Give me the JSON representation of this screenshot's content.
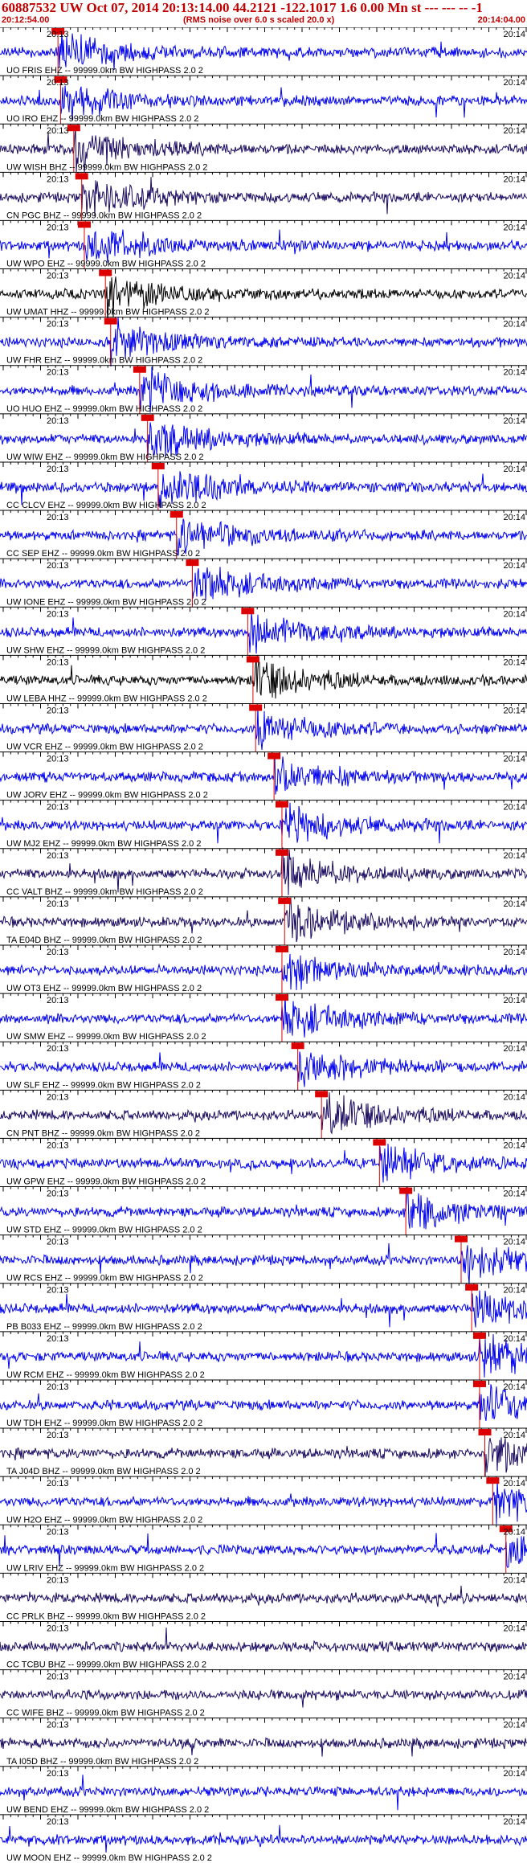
{
  "header": {
    "title": "60887532 UW Oct 07, 2014 20:13:14.00   44.2121 -122.1017  1.6 0.00 Mn st --- --- -- -1",
    "time_start": "20:12:54.00",
    "rms_note": "(RMS noise over 6.0 s scaled 20.0 x)",
    "time_end": "20:14:04.00"
  },
  "colors": {
    "trace": "#0000ee",
    "dark": "#000000",
    "navy": "#1a0a60",
    "pick": "#dd0000",
    "text": "#c00000"
  },
  "traces": [
    {
      "station": "UO FRIS",
      "label": "UO FRIS EHZ -- 99999.0km BW  HIGHPASS  2.0  2",
      "t_left": "20:13",
      "t_right": "20:14",
      "pick": 0.11,
      "color": "blue"
    },
    {
      "station": "UO IRO",
      "label": "UO IRO  EHZ -- 99999.0km BW  HIGHPASS  2.0  2",
      "t_left": "20:13",
      "t_right": "20:14",
      "pick": 0.115,
      "color": "blue"
    },
    {
      "station": "UW WISH",
      "label": "UW WISH BHZ -- 99999.0km BW  HIGHPASS  2.0  2",
      "t_left": "20:13",
      "t_right": "20:14",
      "pick": 0.14,
      "color": "navy"
    },
    {
      "station": "CN PGC",
      "label": "CN PGC  BHZ -- 99999.0km BW  HIGHPASS  2.0  2",
      "t_left": "20:13",
      "t_right": "20:14",
      "pick": 0.155,
      "color": "navy"
    },
    {
      "station": "UW WPO",
      "label": "UW WPO  EHZ -- 99999.0km BW  HIGHPASS  2.0  2",
      "t_left": "20:13",
      "t_right": "20:14",
      "pick": 0.16,
      "color": "blue"
    },
    {
      "station": "UW UMAT",
      "label": "UW UMAT HHZ -- 99999.0km BW  HIGHPASS  2.0  2",
      "t_left": "20:13",
      "t_right": "20:14",
      "pick": 0.2,
      "color": "dark"
    },
    {
      "station": "UW FHR",
      "label": "UW FHR  EHZ -- 99999.0km BW  HIGHPASS  2.0  2",
      "t_left": "20:13",
      "t_right": "20:14",
      "pick": 0.21,
      "color": "blue"
    },
    {
      "station": "UO HUO",
      "label": "UO HUO  EHZ -- 99999.0km BW  HIGHPASS  2.0  2",
      "t_left": "20:13",
      "t_right": "20:14",
      "pick": 0.265,
      "color": "blue"
    },
    {
      "station": "UW WIW",
      "label": "UW WIW  EHZ -- 99999.0km BW  HIGHPASS  2.0  2",
      "t_left": "20:13",
      "t_right": "20:14",
      "pick": 0.28,
      "color": "blue"
    },
    {
      "station": "CC CLCV",
      "label": "CC CLCV EHZ -- 99999.0km BW  HIGHPASS  2.0  2",
      "t_left": "20:13",
      "t_right": "20:14",
      "pick": 0.3,
      "color": "blue"
    },
    {
      "station": "CC SEP",
      "label": "CC SEP  EHZ -- 99999.0km BW  HIGHPASS  2.0  2",
      "t_left": "20:13",
      "t_right": "20:14",
      "pick": 0.335,
      "color": "blue"
    },
    {
      "station": "UW IONE",
      "label": "UW IONE EHZ -- 99999.0km BW  HIGHPASS  2.0  2",
      "t_left": "20:13",
      "t_right": "20:14",
      "pick": 0.365,
      "color": "blue"
    },
    {
      "station": "UW SHW",
      "label": "UW SHW  EHZ -- 99999.0km BW  HIGHPASS  2.0  2",
      "t_left": "20:13",
      "t_right": "20:14",
      "pick": 0.47,
      "color": "blue"
    },
    {
      "station": "UW LEBA",
      "label": "UW LEBA HHZ -- 99999.0km BW  HIGHPASS  2.0  2",
      "t_left": "20:13",
      "t_right": "20:14",
      "pick": 0.48,
      "color": "dark"
    },
    {
      "station": "UW VCR",
      "label": "UW VCR  EHZ -- 99999.0km BW  HIGHPASS  2.0  2",
      "t_left": "20:13",
      "t_right": "20:14",
      "pick": 0.485,
      "color": "blue"
    },
    {
      "station": "UW JORV",
      "label": "UW JORV EHZ -- 99999.0km BW  HIGHPASS  2.0  2",
      "t_left": "20:13",
      "t_right": "20:14",
      "pick": 0.52,
      "color": "blue"
    },
    {
      "station": "UW MJ2",
      "label": "UW MJ2  EHZ -- 99999.0km BW  HIGHPASS  2.0  2",
      "t_left": "20:13",
      "t_right": "20:14",
      "pick": 0.535,
      "color": "blue"
    },
    {
      "station": "CC VALT",
      "label": "CC VALT BHZ -- 99999.0km BW  HIGHPASS  2.0  2",
      "t_left": "20:13",
      "t_right": "20:14",
      "pick": 0.535,
      "color": "navy"
    },
    {
      "station": "TA E04D",
      "label": "TA E04D BHZ -- 99999.0km BW  HIGHPASS  2.0  2",
      "t_left": "20:13",
      "t_right": "20:14",
      "pick": 0.54,
      "color": "navy"
    },
    {
      "station": "UW OT3",
      "label": "UW OT3  EHZ -- 99999.0km BW  HIGHPASS  2.0  2",
      "t_left": "20:13",
      "t_right": "20:14",
      "pick": 0.535,
      "color": "blue"
    },
    {
      "station": "UW SMW",
      "label": "UW SMW  EHZ -- 99999.0km BW  HIGHPASS  2.0  2",
      "t_left": "20:13",
      "t_right": "20:14",
      "pick": 0.535,
      "color": "blue"
    },
    {
      "station": "UW SLF",
      "label": "UW SLF  EHZ -- 99999.0km BW  HIGHPASS  2.0  2",
      "t_left": "20:13",
      "t_right": "20:14",
      "pick": 0.565,
      "color": "blue"
    },
    {
      "station": "CN PNT",
      "label": "CN PNT  BHZ -- 99999.0km BW  HIGHPASS  2.0  2",
      "t_left": "20:13",
      "t_right": "20:14",
      "pick": 0.61,
      "color": "navy"
    },
    {
      "station": "UW GPW",
      "label": "UW GPW  EHZ -- 99999.0km BW  HIGHPASS  2.0  2",
      "t_left": "20:13",
      "t_right": "20:14",
      "pick": 0.72,
      "color": "blue"
    },
    {
      "station": "UW STD",
      "label": "UW STD  EHZ -- 99999.0km BW  HIGHPASS  2.0  2",
      "t_left": "20:13",
      "t_right": "20:14",
      "pick": 0.77,
      "color": "blue"
    },
    {
      "station": "UW RCS",
      "label": "UW RCS  EHZ -- 99999.0km BW  HIGHPASS  2.0  2",
      "t_left": "20:13",
      "t_right": "20:14",
      "pick": 0.875,
      "color": "blue"
    },
    {
      "station": "PB B033",
      "label": "PB B033 EHZ -- 99999.0km BW  HIGHPASS  2.0  2",
      "t_left": "20:13",
      "t_right": "20:14",
      "pick": 0.895,
      "color": "blue"
    },
    {
      "station": "UW RCM",
      "label": "UW RCM  EHZ -- 99999.0km BW  HIGHPASS  2.0  2",
      "t_left": "20:13",
      "t_right": "20:14",
      "pick": 0.91,
      "color": "blue"
    },
    {
      "station": "UW TDH",
      "label": "UW TDH  EHZ -- 99999.0km BW  HIGHPASS  2.0  2",
      "t_left": "20:13",
      "t_right": "20:14",
      "pick": 0.91,
      "color": "blue"
    },
    {
      "station": "TA J04D",
      "label": "TA J04D BHZ -- 99999.0km BW  HIGHPASS  2.0  2",
      "t_left": "20:13",
      "t_right": "20:14",
      "pick": 0.92,
      "color": "navy"
    },
    {
      "station": "UW H2O",
      "label": "UW H2O  EHZ -- 99999.0km BW  HIGHPASS  2.0  2",
      "t_left": "20:13",
      "t_right": "20:14",
      "pick": 0.935,
      "color": "blue"
    },
    {
      "station": "UW LRIV",
      "label": "UW LRIV EHZ -- 99999.0km BW  HIGHPASS  2.0  2",
      "t_left": "20:13",
      "t_right": "20:14",
      "pick": 0.96,
      "color": "blue"
    },
    {
      "station": "CC PRLK",
      "label": "CC PRLK BHZ -- 99999.0km BW  HIGHPASS  2.0  2",
      "t_left": "20:13",
      "t_right": "20:14",
      "pick": null,
      "color": "navy"
    },
    {
      "station": "CC TCBU",
      "label": "CC TCBU BHZ -- 99999.0km BW  HIGHPASS  2.0  2",
      "t_left": "20:13",
      "t_right": "20:14",
      "pick": null,
      "color": "navy"
    },
    {
      "station": "CC WIFE",
      "label": "CC WIFE BHZ -- 99999.0km BW  HIGHPASS  2.0  2",
      "t_left": "20:13",
      "t_right": "20:14",
      "pick": null,
      "color": "navy"
    },
    {
      "station": "TA I05D",
      "label": "TA I05D BHZ -- 99999.0km BW  HIGHPASS  2.0  2",
      "t_left": "20:13",
      "t_right": "20:14",
      "pick": null,
      "color": "navy"
    },
    {
      "station": "UW BEND",
      "label": "UW BEND EHZ -- 99999.0km BW  HIGHPASS  2.0  2",
      "t_left": "20:13",
      "t_right": "20:14",
      "pick": null,
      "color": "blue"
    },
    {
      "station": "UW MOON",
      "label": "UW MOON EHZ -- 99999.0km BW  HIGHPASS  2.0  2",
      "t_left": "20:13",
      "t_right": "20:14",
      "pick": null,
      "color": "blue"
    }
  ]
}
